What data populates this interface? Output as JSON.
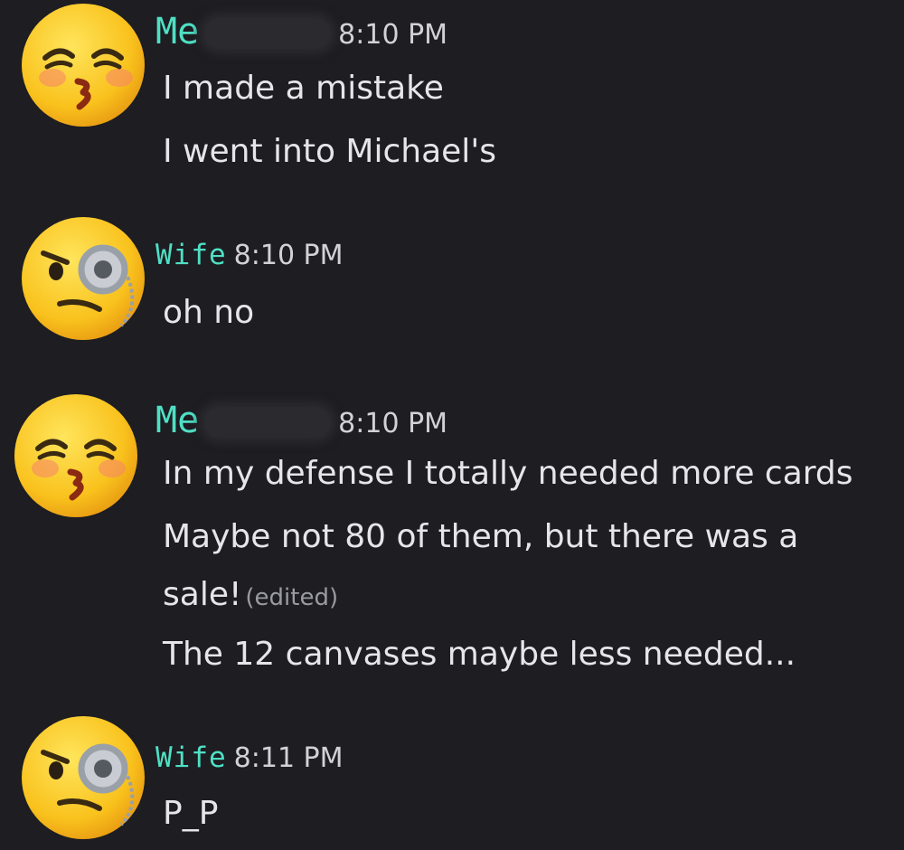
{
  "messages": [
    {
      "author": "Me",
      "time": "8:10 PM",
      "avatar": "kissing-face-closed-eyes",
      "lines": [
        "I made a mistake",
        "I went into Michael's"
      ]
    },
    {
      "author": "Wife",
      "time": "8:10 PM",
      "avatar": "face-with-monocle",
      "lines": [
        "oh no"
      ]
    },
    {
      "author": "Me",
      "time": "8:10 PM",
      "avatar": "kissing-face-closed-eyes",
      "lines": [
        "In my defense I totally needed more cards",
        "Maybe not 80 of them, but there was a",
        "sale!",
        "The 12 canvases maybe less needed..."
      ],
      "edited_label": "(edited)"
    },
    {
      "author": "Wife",
      "time": "8:11 PM",
      "avatar": "face-with-monocle",
      "lines": [
        "P_P"
      ]
    }
  ],
  "colors": {
    "background": "#1d1d22",
    "username": "#4fe0c4",
    "text": "#e6e6ea",
    "timestamp": "#d2d2d6",
    "edited": "#9a9aa2"
  }
}
